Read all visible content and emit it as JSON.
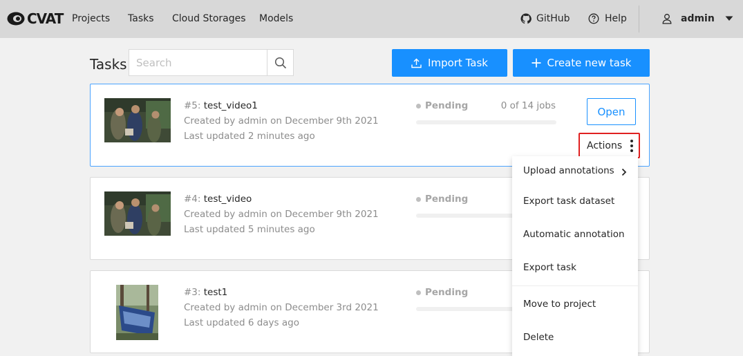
{
  "header": {
    "logo_text": "CVAT",
    "nav": [
      "Projects",
      "Tasks",
      "Cloud Storages",
      "Models"
    ],
    "github_label": "GitHub",
    "help_label": "Help",
    "user_label": "admin"
  },
  "toolbar": {
    "title": "Tasks",
    "search_placeholder": "Search",
    "import_label": "Import Task",
    "create_label": "Create new task"
  },
  "tasks": [
    {
      "id_label": "#5: ",
      "name": "test_video1",
      "created": "Created by admin on December 9th 2021",
      "updated": "Last updated 2 minutes ago",
      "status": "Pending",
      "jobs": "0 of 14 jobs",
      "progress": 0,
      "open_label": "Open",
      "actions_label": "Actions"
    },
    {
      "id_label": "#4: ",
      "name": "test_video",
      "created": "Created by admin on December 9th 2021",
      "updated": "Last updated 5 minutes ago",
      "status": "Pending"
    },
    {
      "id_label": "#3: ",
      "name": "test1",
      "created": "Created by admin on December 3rd 2021",
      "updated": "Last updated 6 days ago",
      "status": "Pending"
    }
  ],
  "menu": {
    "items": [
      "Upload annotations",
      "Export task dataset",
      "Automatic annotation",
      "Export task",
      "Move to project",
      "Delete"
    ]
  },
  "colors": {
    "primary": "#1890ff",
    "highlight_border": "#e02020",
    "header_bg": "#d8d8d8",
    "page_bg": "#f1f1f1"
  }
}
